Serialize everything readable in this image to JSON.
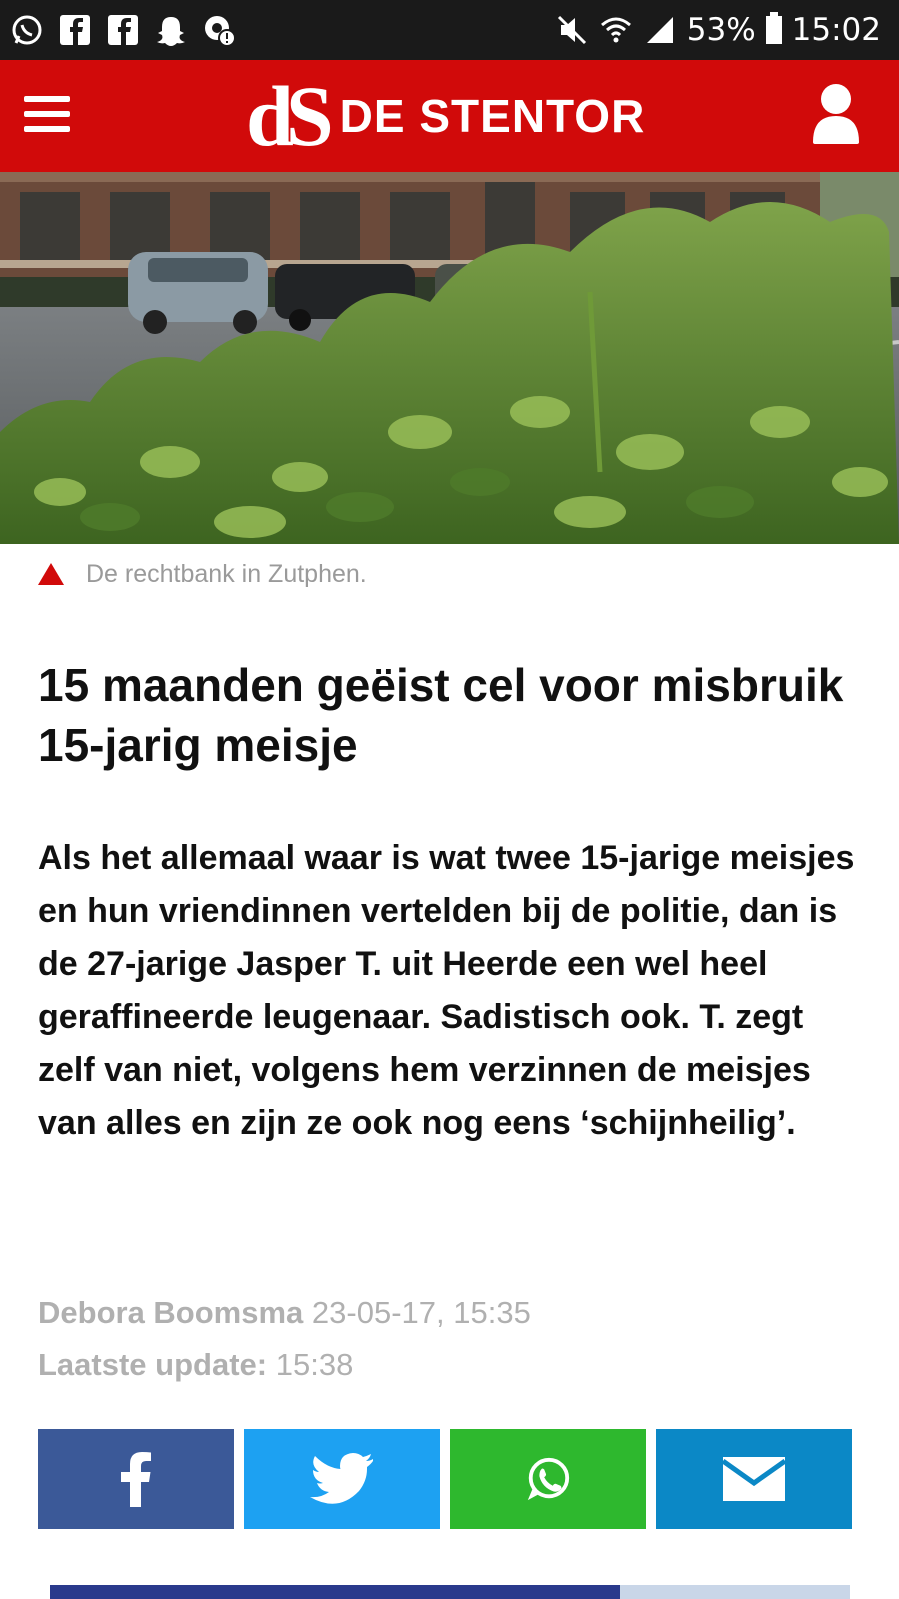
{
  "status_bar": {
    "battery": "53%",
    "time": "15:02",
    "left_icons": [
      "whatsapp-icon",
      "facebook-icon",
      "facebook-icon",
      "snapchat-icon",
      "chrome-alert-icon"
    ],
    "right_icons": [
      "mute-icon",
      "wifi-icon",
      "signal-icon",
      "battery-icon"
    ]
  },
  "header": {
    "logo_mark": "dS",
    "logo_text": "DE STENTOR",
    "brand_color": "#d10a0a"
  },
  "article": {
    "caption": "De rechtbank in Zutphen.",
    "headline": "15 maanden geëist cel voor misbruik 15-jarig meisje",
    "intro": "Als het allemaal waar is wat twee 15-jarige meisjes en hun vriendinnen vertelden bij de politie, dan is de 27-jarige Jasper T. uit Heerde een wel heel geraffineerde leugenaar. Sadistisch ook. T. zegt zelf van niet, volgens hem verzinnen de meisjes van alles en zijn ze ook nog eens ‘schijnheilig’.",
    "author": "Debora Boomsma",
    "published": "23-05-17, 15:35",
    "update_label": "Laatste update:",
    "update_time": "15:38"
  },
  "share": {
    "buttons": [
      {
        "icon": "facebook-icon",
        "color": "#3b5998"
      },
      {
        "icon": "twitter-icon",
        "color": "#1da1f2"
      },
      {
        "icon": "whatsapp-icon",
        "color": "#2eb82e"
      },
      {
        "icon": "mail-icon",
        "color": "#0b88c6"
      }
    ]
  }
}
